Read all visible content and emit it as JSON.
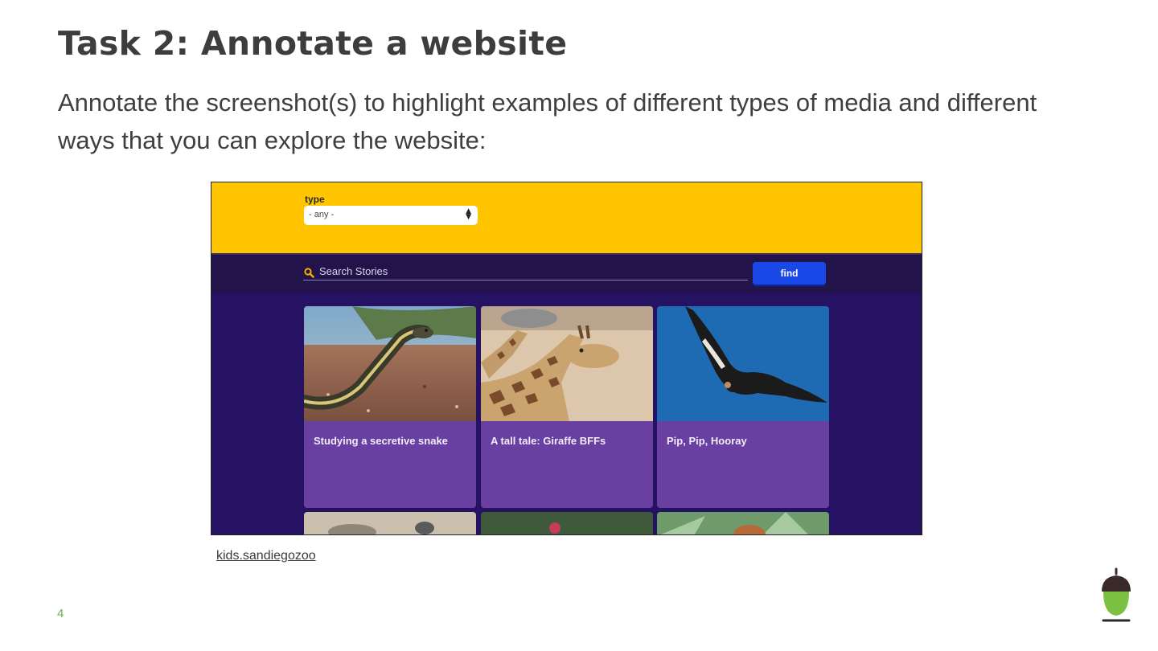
{
  "slide": {
    "title": "Task 2: Annotate a website",
    "subtitle": "Annotate the screenshot(s) to highlight examples of different types of media and different ways that you can explore the website:",
    "link_text": "kids.sandiegozoo",
    "page_number": "4"
  },
  "website": {
    "filter": {
      "label": "type",
      "selected": "- any -"
    },
    "search": {
      "placeholder": "Search Stories",
      "button_label": "find"
    },
    "cards": [
      {
        "title": "Studying a secretive snake",
        "image": "snake-photo"
      },
      {
        "title": "A tall tale: Giraffe BFFs",
        "image": "giraffe-photo"
      },
      {
        "title": "Pip, Pip, Hooray",
        "image": "condor-photo"
      }
    ],
    "colors": {
      "header_yellow": "#ffc600",
      "background_purple": "#261263",
      "card_purple": "#6a3fa2",
      "find_blue": "#1947e8"
    }
  },
  "icons": [
    "search-icon",
    "select-arrows-icon",
    "acorn-logo-icon"
  ]
}
